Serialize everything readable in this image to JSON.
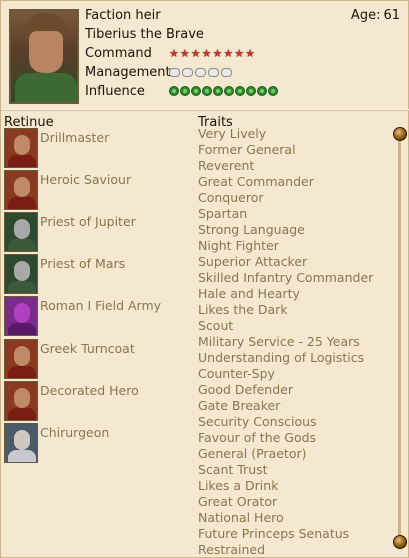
{
  "header": {
    "title": "Faction heir",
    "name": "Tiberius the Brave",
    "age_label": "Age:",
    "age_value": "61"
  },
  "stats": {
    "command_label": "Command",
    "command_value": 8,
    "management_label": "Management",
    "management_value": 5,
    "influence_label": "Influence",
    "influence_value": 10
  },
  "retinue": {
    "heading": "Retinue",
    "items": [
      {
        "label": "Drillmaster",
        "icon": "soldier-portrait-icon"
      },
      {
        "label": "Heroic Saviour",
        "icon": "soldier-portrait-icon"
      },
      {
        "label": "Priest of Jupiter",
        "icon": "priest-portrait-icon"
      },
      {
        "label": "Priest of Mars",
        "icon": "priest-portrait-icon"
      },
      {
        "label": "Roman I Field Army",
        "icon": "legion-banner-icon"
      },
      {
        "label": "Greek Turncoat",
        "icon": "soldier-portrait-icon"
      },
      {
        "label": "Decorated Hero",
        "icon": "soldier-portrait-icon"
      },
      {
        "label": "Chirurgeon",
        "icon": "elder-portrait-icon"
      }
    ]
  },
  "traits": {
    "heading": "Traits",
    "items": [
      "Very Lively",
      "Former General",
      "Reverent",
      "Great Commander",
      "Conqueror",
      "Spartan",
      "Strong Language",
      "Night Fighter",
      "Superior Attacker",
      "Skilled Infantry Commander",
      "Hale and Hearty",
      "Likes the Dark",
      "Scout",
      "Military Service - 25 Years",
      "Understanding of Logistics",
      "Counter-Spy",
      "Good Defender",
      "Gate Breaker",
      "Security Conscious",
      "Favour of the Gods",
      "General (Praetor)",
      "Scant Trust",
      "Likes a Drink",
      "Great Orator",
      "National Hero",
      "Future Princeps Senatus",
      "Restrained"
    ]
  },
  "colors": {
    "background": "#f4e9d0",
    "muted_text": "#8a7550",
    "command_star": "#c0392b",
    "influence_laurel": "#2e8a2e"
  }
}
